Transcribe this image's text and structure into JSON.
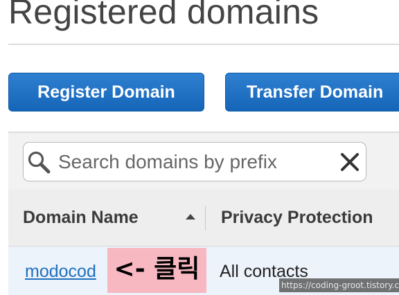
{
  "page": {
    "title": "Registered domains"
  },
  "actions": {
    "register_label": "Register Domain",
    "transfer_label": "Transfer Domain"
  },
  "search": {
    "placeholder": "Search domains by prefix",
    "icon": "search-icon",
    "clear_icon": "close-icon"
  },
  "table": {
    "columns": [
      {
        "label": "Domain Name",
        "sort": "ascending"
      },
      {
        "label": "Privacy Protection"
      }
    ],
    "rows": [
      {
        "domain": "modocod",
        "privacy": "All contacts"
      }
    ]
  },
  "annotation": {
    "text": "<- 클릭",
    "color": "#f8b8c2"
  },
  "watermark": {
    "text": "https://coding-groot.tistory.com"
  },
  "colors": {
    "accent": "#1565b8",
    "link": "#1f6fbf"
  }
}
